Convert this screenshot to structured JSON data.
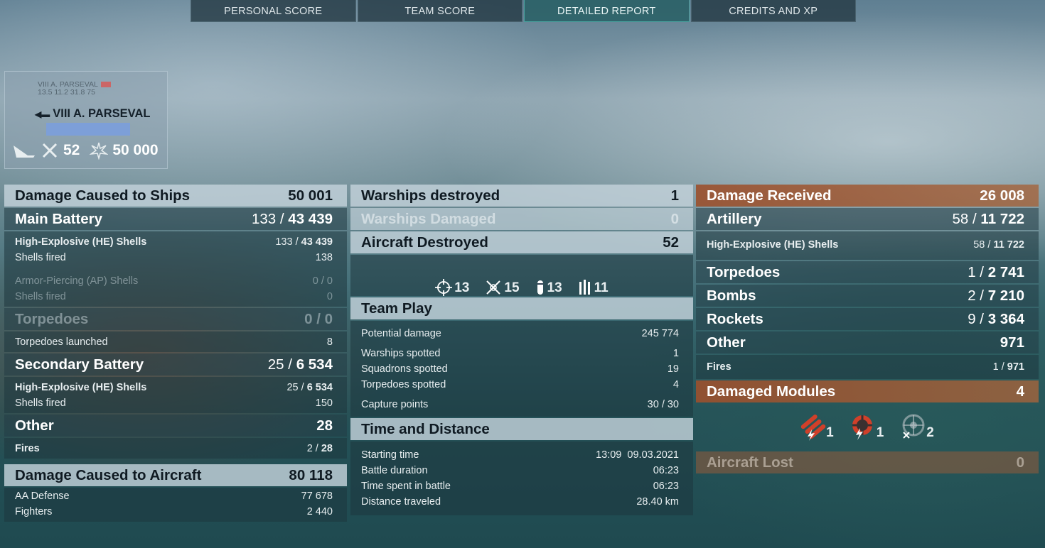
{
  "tabs": [
    "PERSONAL SCORE",
    "TEAM SCORE",
    "DETAILED REPORT",
    "CREDITS AND XP"
  ],
  "ship": {
    "mini_name": "VIII A. PARSEVAL",
    "mini_stats": "13.5 11.2 31.8 75",
    "name": "VIII A. PARSEVAL",
    "planes_killed": "52",
    "damage": "50 000",
    "hp_bar_color": "#7d9fd8"
  },
  "left": {
    "damage_ships": {
      "label": "Damage Caused to Ships",
      "value": "50 001"
    },
    "main_battery": {
      "label": "Main Battery",
      "hits": "133",
      "damage": "43 439"
    },
    "he_main": {
      "label": "High-Explosive (HE) Shells",
      "hits": "133",
      "damage": "43 439"
    },
    "he_main_fired": {
      "label": "Shells fired",
      "value": "138"
    },
    "ap": {
      "label": "Armor-Piercing (AP) Shells",
      "value": "0 / 0"
    },
    "ap_fired": {
      "label": "Shells fired",
      "value": "0"
    },
    "torpedoes": {
      "label": "Torpedoes",
      "value": "0 / 0"
    },
    "torpedoes_launched": {
      "label": "Torpedoes launched",
      "value": "8"
    },
    "secondary": {
      "label": "Secondary Battery",
      "hits": "25",
      "damage": "6 534"
    },
    "he_sec": {
      "label": "High-Explosive (HE) Shells",
      "hits": "25",
      "damage": "6 534"
    },
    "he_sec_fired": {
      "label": "Shells fired",
      "value": "150"
    },
    "other": {
      "label": "Other",
      "value": "28"
    },
    "fires": {
      "label": "Fires",
      "hits": "2",
      "damage": "28"
    },
    "damage_aircraft": {
      "label": "Damage Caused to Aircraft",
      "value": "80 118"
    },
    "aa_defense": {
      "label": "AA Defense",
      "value": "77 678"
    },
    "fighters": {
      "label": "Fighters",
      "value": "2 440"
    }
  },
  "center": {
    "warships_destroyed": {
      "label": "Warships destroyed",
      "value": "1"
    },
    "warships_damaged": {
      "label": "Warships Damaged",
      "value": "0"
    },
    "aircraft_destroyed": {
      "label": "Aircraft Destroyed",
      "value": "52"
    },
    "aircraft_types": [
      {
        "icon": "crosshair-icon",
        "value": "13"
      },
      {
        "icon": "fighter-x-icon",
        "value": "15"
      },
      {
        "icon": "bomb-icon",
        "value": "13"
      },
      {
        "icon": "rockets-icon",
        "value": "11"
      }
    ],
    "team_play": {
      "label": "Team Play"
    },
    "potential_damage": {
      "label": "Potential damage",
      "value": "245 774"
    },
    "warships_spotted": {
      "label": "Warships spotted",
      "value": "1"
    },
    "squadrons_spotted": {
      "label": "Squadrons spotted",
      "value": "19"
    },
    "torpedoes_spotted": {
      "label": "Torpedoes spotted",
      "value": "4"
    },
    "capture_points": {
      "label": "Capture points",
      "value": "30 / 30"
    },
    "time_distance": {
      "label": "Time and Distance"
    },
    "starting_time": {
      "label": "Starting time",
      "value": "13:09  09.03.2021"
    },
    "battle_duration": {
      "label": "Battle duration",
      "value": "06:23"
    },
    "time_spent": {
      "label": "Time spent in battle",
      "value": "06:23"
    },
    "distance": {
      "label": "Distance traveled",
      "value": "28.40 km"
    }
  },
  "right": {
    "damage_received": {
      "label": "Damage Received",
      "value": "26 008"
    },
    "artillery": {
      "label": "Artillery",
      "hits": "58",
      "damage": "11 722"
    },
    "he": {
      "label": "High-Explosive (HE) Shells",
      "hits": "58",
      "damage": "11 722"
    },
    "torpedoes": {
      "label": "Torpedoes",
      "hits": "1",
      "damage": "2 741"
    },
    "bombs": {
      "label": "Bombs",
      "hits": "2",
      "damage": "7 210"
    },
    "rockets": {
      "label": "Rockets",
      "hits": "9",
      "damage": "3 364"
    },
    "other": {
      "label": "Other",
      "value": "971"
    },
    "fires": {
      "label": "Fires",
      "hits": "1",
      "damage": "971"
    },
    "damaged_modules": {
      "label": "Damaged Modules",
      "value": "4"
    },
    "modules": [
      {
        "icon": "torpedo-tubes-damaged-icon",
        "value": "1"
      },
      {
        "icon": "engine-damaged-icon",
        "value": "1"
      },
      {
        "icon": "steering-gear-icon",
        "value": "2"
      }
    ],
    "aircraft_lost": {
      "label": "Aircraft Lost",
      "value": "0"
    }
  },
  "colors": {
    "accent_tab": "#2a5f64",
    "orange_header": "#9b502d",
    "hp_bar": "#7d9fd8"
  }
}
